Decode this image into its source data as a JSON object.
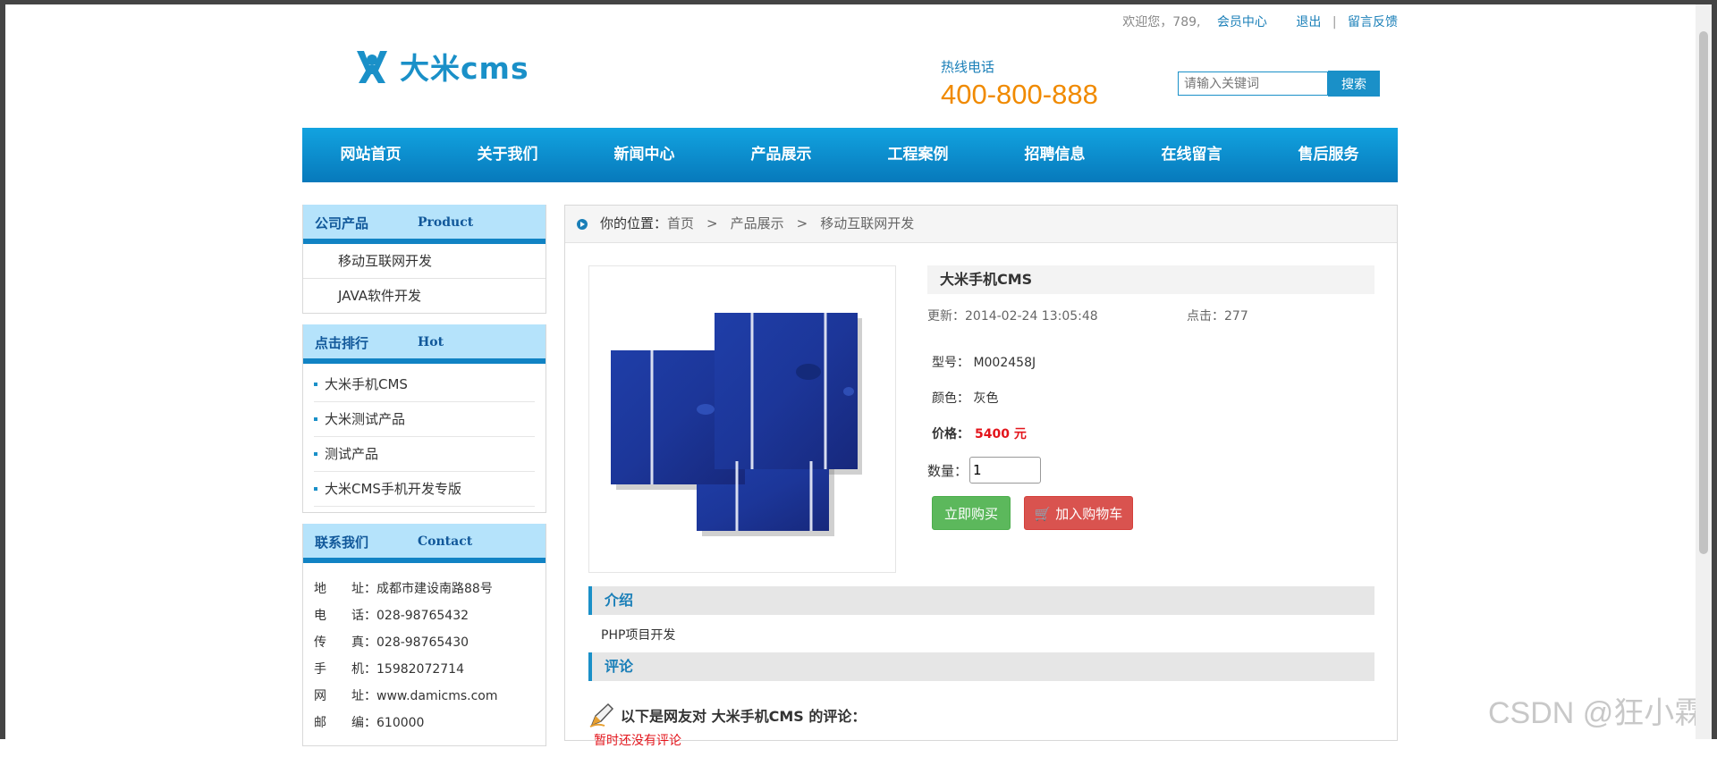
{
  "topbar": {
    "welcome": "欢迎您，789,",
    "member_center": "会员中心",
    "logout": "退出",
    "separator": "|",
    "feedback": "留言反馈"
  },
  "header": {
    "logo_text": "大米cms",
    "hotline_label": "热线电话",
    "hotline_number": "400-800-888",
    "search_placeholder": "请输入关键词",
    "search_button": "搜索",
    "brand_color": "#1a90c8"
  },
  "nav": {
    "items": [
      "网站首页",
      "关于我们",
      "新闻中心",
      "产品展示",
      "工程案例",
      "招聘信息",
      "在线留言",
      "售后服务"
    ]
  },
  "sidebar": {
    "products": {
      "title_cn": "公司产品",
      "title_en": "Product",
      "items": [
        "移动互联网开发",
        "JAVA软件开发"
      ]
    },
    "hot": {
      "title_cn": "点击排行",
      "title_en": "Hot",
      "items": [
        "大米手机CMS",
        "大米测试产品",
        "测试产品",
        "大米CMS手机开发专版"
      ]
    },
    "contact": {
      "title_cn": "联系我们",
      "title_en": "Contact",
      "rows": [
        {
          "k": "地　　址：",
          "v": "成都市建设南路88号"
        },
        {
          "k": "电　　话：",
          "v": "028-98765432"
        },
        {
          "k": "传　　真：",
          "v": "028-98765430"
        },
        {
          "k": "手　　机：",
          "v": "15982072714"
        },
        {
          "k": "网　　址：",
          "v": "www.damicms.com"
        },
        {
          "k": "邮　　编：",
          "v": "610000"
        }
      ]
    }
  },
  "breadcrumb": {
    "label": "你的位置：",
    "items": [
      "首页",
      "产品展示",
      "移动互联网开发"
    ],
    "arrow": ">"
  },
  "product": {
    "title": "大米手机CMS",
    "updated": "更新：2014-02-24 13:05:48",
    "clicks": "点击：277",
    "model": "型号： M002458J",
    "color": "颜色： 灰色",
    "price_label": "价格：",
    "price_value": "5400 元",
    "qty_label": "数量：",
    "qty_value": "1",
    "buy_button": "立即购买",
    "cart_button": "加入购物车"
  },
  "intro": {
    "title": "介绍",
    "text": "PHP项目开发"
  },
  "comments": {
    "title": "评论",
    "heading": "以下是网友对 大米手机CMS 的评论：",
    "empty": "暂时还没有评论"
  },
  "watermark": "CSDN @狂小霖"
}
